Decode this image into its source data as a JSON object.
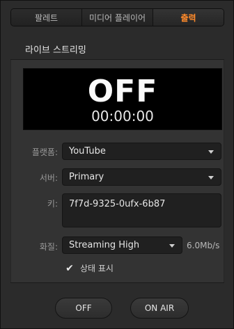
{
  "tabs": [
    {
      "label": "팔레트"
    },
    {
      "label": "미디어 플레이어"
    },
    {
      "label": "출력"
    }
  ],
  "active_tab": 2,
  "accent_color": "#ff8a2a",
  "section_title": "라이브 스트리밍",
  "status": {
    "state": "OFF",
    "timer": "00:00:00"
  },
  "form": {
    "platform": {
      "label": "플랫폼:",
      "value": "YouTube"
    },
    "server": {
      "label": "서버:",
      "value": "Primary"
    },
    "key": {
      "label": "키:",
      "value": "7f7d-9325-0ufx-6b87"
    },
    "quality": {
      "label": "화질:",
      "value": "Streaming High",
      "bitrate": "6.0Mb/s"
    }
  },
  "status_checkbox": {
    "label": "상태 표시",
    "checked": true,
    "icon": "checkmark-icon"
  },
  "buttons": {
    "off": "OFF",
    "on_air": "ON AIR"
  }
}
